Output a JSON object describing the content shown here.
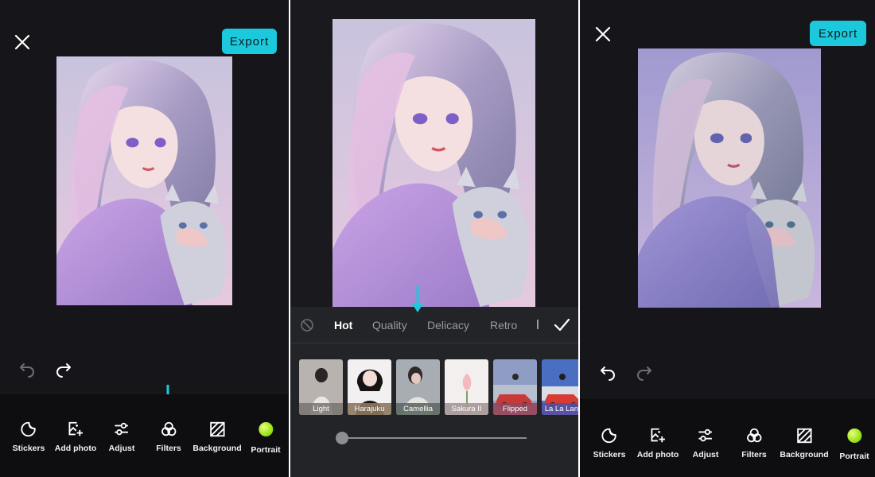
{
  "panels": [
    {
      "export_label": "Export",
      "tools": [
        {
          "label": "Stickers",
          "icon": "sticker-icon"
        },
        {
          "label": "Add photo",
          "icon": "add-photo-icon"
        },
        {
          "label": "Adjust",
          "icon": "sliders-icon"
        },
        {
          "label": "Filters",
          "icon": "filters-icon"
        },
        {
          "label": "Background",
          "icon": "background-icon"
        },
        {
          "label": "Portrait",
          "icon": "portrait-dot-icon"
        }
      ]
    },
    {
      "categories": [
        "Hot",
        "Quality",
        "Delicacy",
        "Retro"
      ],
      "active_category": "Hot",
      "filters": [
        {
          "label": "Light"
        },
        {
          "label": "Harajuku"
        },
        {
          "label": "Camellia"
        },
        {
          "label": "Sakura II"
        },
        {
          "label": "Flipped"
        },
        {
          "label": "La La Land"
        }
      ],
      "intensity": 0
    },
    {
      "export_label": "Export",
      "tools": [
        {
          "label": "Stickers",
          "icon": "sticker-icon"
        },
        {
          "label": "Add photo",
          "icon": "add-photo-icon"
        },
        {
          "label": "Adjust",
          "icon": "sliders-icon"
        },
        {
          "label": "Filters",
          "icon": "filters-icon"
        },
        {
          "label": "Background",
          "icon": "background-icon"
        },
        {
          "label": "Portrait",
          "icon": "portrait-dot-icon"
        }
      ]
    }
  ],
  "colors": {
    "accent": "#1cc9dc",
    "background": "#16161a",
    "toolbar": "#0e0e11",
    "sheet": "#232428"
  }
}
